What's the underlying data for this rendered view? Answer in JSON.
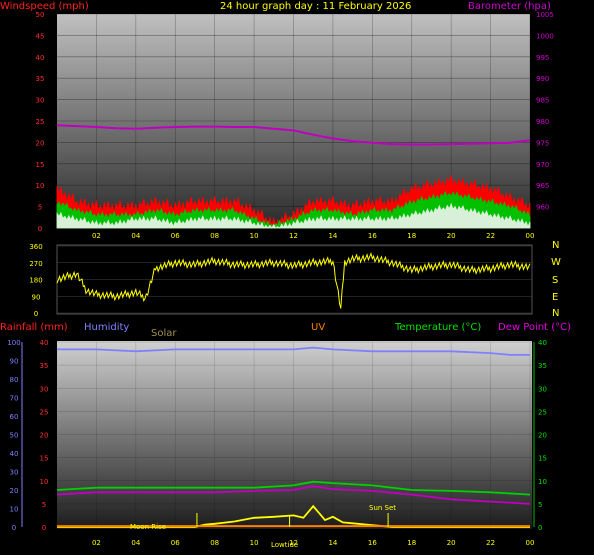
{
  "chart_data": [
    {
      "type": "line",
      "panel": "wind-barometer",
      "title": "24 hour graph day : 11 February 2026",
      "ylabel_left": "Windspeed (mph)",
      "ylabel_right": "Barometer (hpa)",
      "x_ticks": [
        "02",
        "04",
        "06",
        "08",
        "10",
        "12",
        "14",
        "16",
        "18",
        "20",
        "22",
        "00"
      ],
      "ylim_left": [
        0,
        50
      ],
      "yticks_left": [
        "0",
        "5",
        "10",
        "15",
        "20",
        "25",
        "30",
        "35",
        "40",
        "45",
        "50"
      ],
      "ylim_right": [
        955,
        1005
      ],
      "yticks_right": [
        "960",
        "965",
        "970",
        "975",
        "980",
        "985",
        "990",
        "995",
        "1000",
        "1005"
      ],
      "series": [
        {
          "name": "gust",
          "color": "#ff0000",
          "x": [
            0,
            1,
            2,
            3,
            4,
            5,
            6,
            7,
            8,
            9,
            10,
            11,
            12,
            13,
            14,
            15,
            16,
            17,
            18,
            19,
            20,
            21,
            22,
            23,
            24
          ],
          "values": [
            9,
            6,
            5,
            5,
            5,
            6,
            5,
            6,
            6,
            6,
            4,
            1,
            3,
            6,
            6,
            5,
            6,
            6,
            9,
            10,
            11,
            10,
            9,
            7,
            5
          ]
        },
        {
          "name": "average",
          "color": "#00c000",
          "x": [
            0,
            1,
            2,
            3,
            4,
            5,
            6,
            7,
            8,
            9,
            10,
            11,
            12,
            13,
            14,
            15,
            16,
            17,
            18,
            19,
            20,
            21,
            22,
            23,
            24
          ],
          "values": [
            6,
            4,
            3,
            3,
            3,
            4,
            3,
            4,
            4,
            4,
            2,
            0.5,
            2,
            4,
            4,
            3,
            4,
            4,
            6,
            7,
            8,
            7,
            6,
            5,
            3
          ]
        },
        {
          "name": "wind",
          "color": "#d8f0d8",
          "x": [
            0,
            1,
            2,
            3,
            4,
            5,
            6,
            7,
            8,
            9,
            10,
            11,
            12,
            13,
            14,
            15,
            16,
            17,
            18,
            19,
            20,
            21,
            22,
            23,
            24
          ],
          "values": [
            3,
            2,
            1,
            1,
            2,
            2,
            1,
            2,
            2,
            2,
            1,
            0,
            1,
            2,
            2,
            2,
            2,
            2,
            3,
            4,
            5,
            4,
            3,
            2,
            1
          ]
        },
        {
          "name": "barometer",
          "color": "#c000c0",
          "x": [
            0,
            1,
            2,
            3,
            4,
            5,
            6,
            7,
            8,
            9,
            10,
            11,
            12,
            13,
            14,
            15,
            16,
            17,
            18,
            19,
            20,
            21,
            22,
            23,
            24
          ],
          "values": [
            979,
            978.8,
            978.6,
            978.3,
            978.2,
            978.4,
            978.6,
            978.7,
            978.7,
            978.6,
            978.6,
            978.2,
            977.8,
            976.8,
            975.9,
            975.3,
            974.9,
            974.6,
            974.5,
            974.5,
            974.6,
            974.7,
            974.8,
            974.9,
            975.5
          ]
        }
      ]
    },
    {
      "type": "line",
      "panel": "wind-direction",
      "ylim": [
        0,
        360
      ],
      "yticks": [
        "0",
        "90",
        "180",
        "270",
        "360"
      ],
      "compass": [
        "N",
        "W",
        "S",
        "E",
        "N"
      ],
      "series": [
        {
          "name": "direction",
          "color": "#ffff00",
          "x": [
            0,
            1,
            1.5,
            2,
            3,
            4,
            4.5,
            5,
            6,
            7,
            8,
            9,
            10,
            11,
            12,
            13,
            14,
            14.4,
            14.6,
            15,
            16,
            17,
            18,
            19,
            20,
            21,
            22,
            23,
            24
          ],
          "values": [
            180,
            210,
            120,
            100,
            90,
            110,
            80,
            240,
            270,
            260,
            280,
            260,
            260,
            270,
            255,
            270,
            280,
            20,
            275,
            290,
            300,
            270,
            230,
            250,
            260,
            230,
            240,
            260,
            245
          ]
        }
      ]
    },
    {
      "type": "line",
      "panel": "rain-temperature",
      "labels": {
        "rainfall": "Rainfall (mm)",
        "humidity": "Humidity",
        "solar": "Solar",
        "uv": "UV",
        "temperature": "Temperature (°C)",
        "dewpoint": "Dew Point (°C)"
      },
      "ylim_rain": [
        0,
        40
      ],
      "yticks_rain": [
        "0",
        "5",
        "10",
        "15",
        "20",
        "25",
        "30",
        "35",
        "40"
      ],
      "ylim_humidity": [
        0,
        100
      ],
      "yticks_humidity": [
        "0",
        "10",
        "20",
        "30",
        "40",
        "50",
        "60",
        "70",
        "80",
        "90",
        "100"
      ],
      "ylim_temp": [
        0,
        40
      ],
      "yticks_temp": [
        "0",
        "5",
        "10",
        "15",
        "20",
        "25",
        "30",
        "35",
        "40"
      ],
      "annotations": {
        "moonrise": "Moon Rise",
        "sunset": "Sun Set",
        "lowtide": "Lowtide"
      },
      "series": [
        {
          "name": "humidity",
          "color": "#8080ff",
          "x": [
            0,
            2,
            4,
            6,
            8,
            10,
            12,
            13,
            14,
            16,
            18,
            20,
            22,
            23,
            24
          ],
          "values": [
            96,
            96,
            95,
            96,
            96,
            96,
            96,
            97,
            96,
            95,
            95,
            95,
            94,
            93,
            93
          ]
        },
        {
          "name": "temperature",
          "color": "#00d000",
          "x": [
            0,
            2,
            4,
            6,
            8,
            10,
            12,
            13,
            14,
            16,
            18,
            20,
            22,
            24
          ],
          "values": [
            8,
            8.5,
            8.5,
            8.5,
            8.5,
            8.5,
            9,
            9.8,
            9.5,
            9,
            8,
            7.8,
            7.5,
            7
          ]
        },
        {
          "name": "dewpoint",
          "color": "#c000c0",
          "x": [
            0,
            2,
            4,
            6,
            8,
            10,
            12,
            13,
            14,
            16,
            18,
            20,
            22,
            24
          ],
          "values": [
            7,
            7.5,
            7.5,
            7.5,
            7.5,
            7.8,
            8,
            8.8,
            8.2,
            7.8,
            7,
            6,
            5.5,
            5
          ]
        },
        {
          "name": "solar",
          "color": "#ffff00",
          "x": [
            0,
            7,
            7.5,
            8,
            9,
            10,
            11,
            12,
            12.5,
            13,
            13.3,
            13.6,
            14,
            14.5,
            15,
            16,
            16.5,
            17,
            24
          ],
          "values": [
            0,
            0,
            0.5,
            0.7,
            1.2,
            2,
            2.2,
            2.5,
            2,
            4.5,
            3,
            1.5,
            2.2,
            1,
            0.8,
            0.4,
            0.2,
            0,
            0
          ]
        },
        {
          "name": "uv",
          "color": "#ff8000",
          "x": [
            0,
            24
          ],
          "values": [
            0.2,
            0.2
          ]
        }
      ]
    }
  ]
}
